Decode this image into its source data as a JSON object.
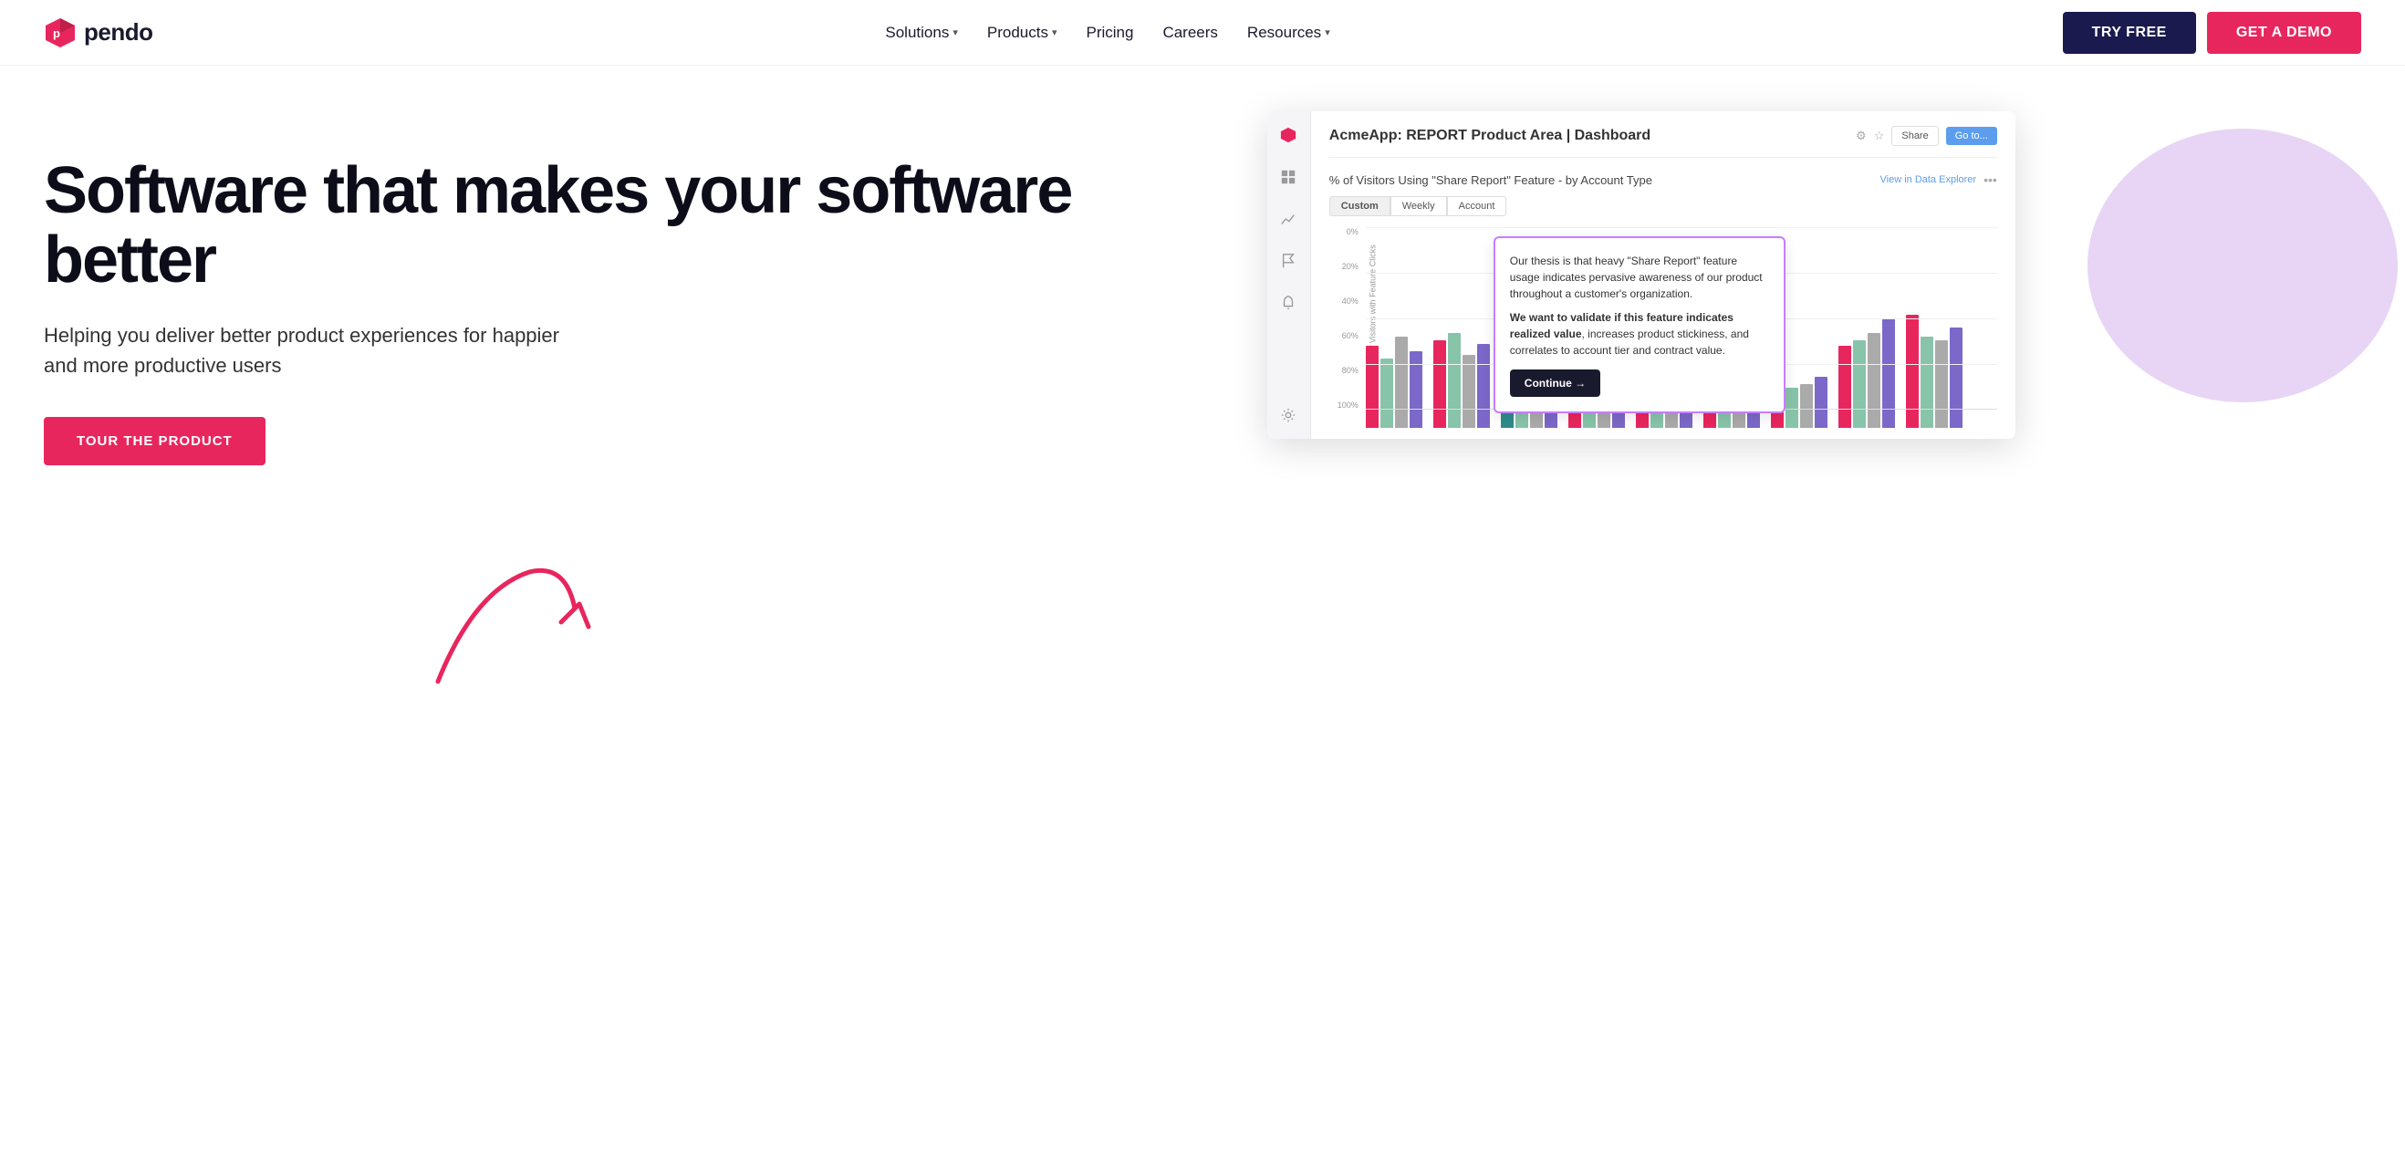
{
  "nav": {
    "logo_text": "pendo",
    "links": [
      {
        "label": "Solutions",
        "has_dropdown": true
      },
      {
        "label": "Products",
        "has_dropdown": true
      },
      {
        "label": "Pricing",
        "has_dropdown": false
      },
      {
        "label": "Careers",
        "has_dropdown": false
      },
      {
        "label": "Resources",
        "has_dropdown": true
      }
    ],
    "try_free": "TRY FREE",
    "get_demo": "GET A DEMO"
  },
  "hero": {
    "title": "Software that makes your software better",
    "subtitle": "Helping you deliver better product experiences for happier and more productive users",
    "cta_label": "TOUR THE PRODUCT"
  },
  "dashboard": {
    "title": "AcmeApp: REPORT Product Area | Dashboard",
    "btn_share": "Share",
    "btn_go_to": "Go to...",
    "chart_title": "% of Visitors Using \"Share Report\" Feature - by Account Type",
    "chart_link": "View in Data Explorer",
    "tabs": [
      "Custom",
      "Weekly",
      "Account"
    ],
    "active_tab": "Custom",
    "y_labels": [
      "100%",
      "80%",
      "60%",
      "40%",
      "20%",
      "0%"
    ],
    "y_axis_label": "Percent of Visitors with Feature Clicks",
    "tooltip": {
      "text1": "Our thesis is that heavy \"Share Report\" feature usage indicates pervasive awareness of our product throughout a customer's organization.",
      "text2_bold": "We want to validate if this feature indicates realized value",
      "text2_rest": ", increases product stickiness, and correlates to account tier and contract value.",
      "continue_btn": "Continue →"
    },
    "bars": [
      {
        "group": [
          {
            "height": 45,
            "color": "#e8265e"
          },
          {
            "height": 38,
            "color": "#88c4aa"
          },
          {
            "height": 50,
            "color": "#aaaaaa"
          },
          {
            "height": 42,
            "color": "#7b68c8"
          }
        ]
      },
      {
        "group": [
          {
            "height": 48,
            "color": "#e8265e"
          },
          {
            "height": 52,
            "color": "#88c4aa"
          },
          {
            "height": 40,
            "color": "#aaaaaa"
          },
          {
            "height": 46,
            "color": "#7b68c8"
          }
        ]
      },
      {
        "group": [
          {
            "height": 10,
            "color": "#2e8b8b"
          },
          {
            "height": 50,
            "color": "#88c4aa"
          },
          {
            "height": 43,
            "color": "#aaaaaa"
          },
          {
            "height": 38,
            "color": "#7b68c8"
          }
        ]
      },
      {
        "group": [
          {
            "height": 46,
            "color": "#e8265e"
          },
          {
            "height": 42,
            "color": "#88c4aa"
          },
          {
            "height": 38,
            "color": "#aaaaaa"
          },
          {
            "height": 48,
            "color": "#7b68c8"
          }
        ]
      },
      {
        "group": [
          {
            "height": 55,
            "color": "#e8265e"
          },
          {
            "height": 50,
            "color": "#88c4aa"
          },
          {
            "height": 44,
            "color": "#aaaaaa"
          },
          {
            "height": 70,
            "color": "#7b68c8"
          }
        ]
      },
      {
        "group": [
          {
            "height": 50,
            "color": "#e8265e"
          },
          {
            "height": 46,
            "color": "#88c4aa"
          },
          {
            "height": 42,
            "color": "#aaaaaa"
          },
          {
            "height": 58,
            "color": "#7b68c8"
          }
        ]
      },
      {
        "group": [
          {
            "height": 20,
            "color": "#e8265e"
          },
          {
            "height": 22,
            "color": "#88c4aa"
          },
          {
            "height": 24,
            "color": "#aaaaaa"
          },
          {
            "height": 28,
            "color": "#7b68c8"
          }
        ]
      },
      {
        "group": [
          {
            "height": 45,
            "color": "#e8265e"
          },
          {
            "height": 48,
            "color": "#88c4aa"
          },
          {
            "height": 52,
            "color": "#aaaaaa"
          },
          {
            "height": 60,
            "color": "#7b68c8"
          }
        ]
      },
      {
        "group": [
          {
            "height": 62,
            "color": "#e8265e"
          },
          {
            "height": 50,
            "color": "#88c4aa"
          },
          {
            "height": 48,
            "color": "#aaaaaa"
          },
          {
            "height": 55,
            "color": "#7b68c8"
          }
        ]
      }
    ]
  },
  "colors": {
    "nav_dark": "#1a1a4e",
    "pink": "#e8265e",
    "purple_blob": "#e8d5f5",
    "bar_pink": "#e8265e",
    "bar_green": "#88c4aa",
    "bar_gray": "#aaaaaa",
    "bar_purple": "#7b68c8",
    "bar_teal": "#2e8b8b",
    "tooltip_border": "#c77dff"
  }
}
